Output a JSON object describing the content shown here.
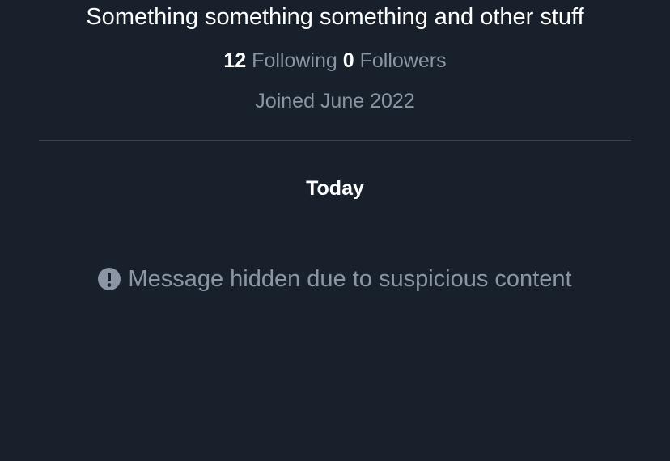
{
  "profile": {
    "bio": "Something something something and other stuff",
    "following_count": "12",
    "following_label": "Following",
    "followers_count": "0",
    "followers_label": "Followers",
    "joined": "Joined June 2022"
  },
  "conversation": {
    "date_header": "Today",
    "hidden_message": "Message hidden due to suspicious content",
    "hidden_icon": "exclamation-circle-icon"
  },
  "colors": {
    "background": "#18202b",
    "primary_text": "#ffffff",
    "secondary_text": "#8b95a3",
    "divider": "#3a4451"
  }
}
